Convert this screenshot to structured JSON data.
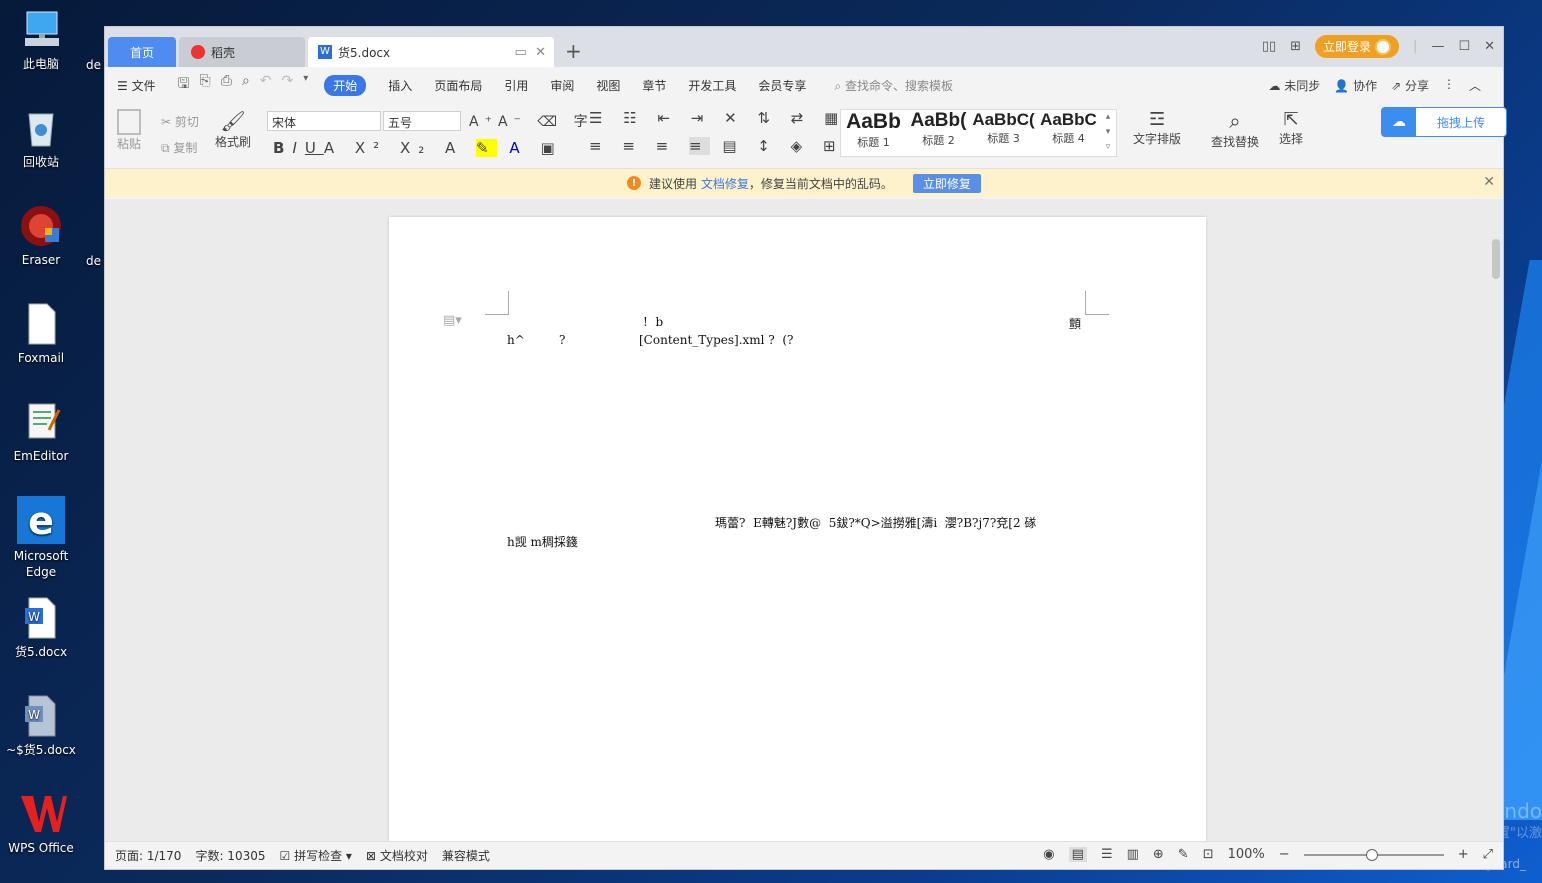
{
  "desktop": {
    "icons": [
      {
        "label": "此电脑",
        "icon": "computer-icon"
      },
      {
        "label": "回收站",
        "icon": "recycle-bin-icon"
      },
      {
        "label": "Eraser",
        "icon": "eraser-icon"
      },
      {
        "label": "Foxmail",
        "icon": "file-icon"
      },
      {
        "label": "EmEditor",
        "icon": "emeditor-icon"
      },
      {
        "label": "Microsoft Edge",
        "icon": "edge-icon"
      },
      {
        "label": "货5.docx",
        "icon": "word-doc-icon"
      },
      {
        "label": "~$货5.docx",
        "icon": "word-doc-icon"
      },
      {
        "label": "WPS Office",
        "icon": "wps-icon"
      }
    ],
    "partial_labels": [
      "de",
      "de"
    ],
    "watermark_line1": "激活 Windo",
    "watermark_line2": "转到\"设置\"以激",
    "csdn": "CSDN @Gignard_"
  },
  "tabs": {
    "home": "首页",
    "daoke": "稻壳",
    "doc": "货5.docx"
  },
  "titlebar": {
    "login": "立即登录"
  },
  "menubar": {
    "file": "文件",
    "items": [
      "开始",
      "插入",
      "页面布局",
      "引用",
      "审阅",
      "视图",
      "章节",
      "开发工具",
      "会员专享"
    ],
    "search": "查找命令、搜索模板",
    "right": [
      "未同步",
      "协作",
      "分享"
    ]
  },
  "ribbon": {
    "paste": "粘贴",
    "cut": "剪切",
    "copy": "复制",
    "format_painter": "格式刷",
    "font": "宋体",
    "size": "五号",
    "styles": [
      {
        "preview": "AaBb",
        "label": "标题 1"
      },
      {
        "preview": "AaBb(",
        "label": "标题 2"
      },
      {
        "preview": "AaBbC(",
        "label": "标题 3"
      },
      {
        "preview": "AaBbC",
        "label": "标题 4"
      }
    ],
    "text_layout": "文字排版",
    "find_replace": "查找替换",
    "select": "选择",
    "upload": "拖拽上传"
  },
  "notice": {
    "prefix": "建议使用",
    "link": "文档修复",
    "suffix": "，修复当前文档中的乱码。",
    "button": "立即修复"
  },
  "document": {
    "line1a": "!  b",
    "line1b": "顫",
    "line2a": "h^",
    "line2b": "?",
    "line2c": "[Content_Types].xml ?  (?",
    "line3a": "瑪蕾?  E轉魅?J數@  5鈸?*Q>溢撈雅[濤i  瀴?B?j7?兗[2 䃍",
    "line4a": "h觊 m稠採籛"
  },
  "status": {
    "page": "页面: 1/170",
    "words": "字数: 10305",
    "spell": "拼写检查",
    "proof": "文档校对",
    "compat": "兼容模式",
    "zoom": "100%"
  }
}
